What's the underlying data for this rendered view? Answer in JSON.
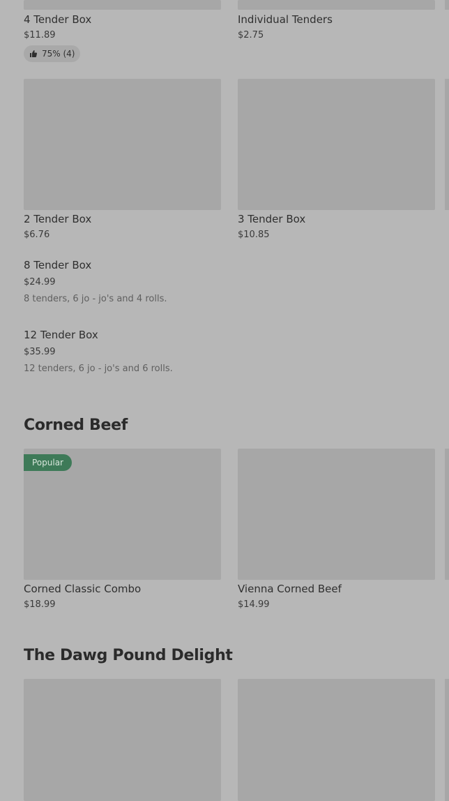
{
  "tenders": {
    "items": [
      {
        "name": "4 Tender Box",
        "price": "$11.89",
        "rating": "75% (4)"
      },
      {
        "name": "Individual Tenders",
        "price": "$2.75"
      },
      {
        "name": "2 Tender Box",
        "price": "$6.76"
      },
      {
        "name": "3 Tender Box",
        "price": "$10.85"
      },
      {
        "name": "8 Tender Box",
        "price": "$24.99",
        "description": "8 tenders, 6 jo - jo's and 4 rolls."
      },
      {
        "name": "12 Tender Box",
        "price": "$35.99",
        "description": "12 tenders, 6 jo - jo's and 6 rolls."
      }
    ]
  },
  "corned_beef": {
    "title": "Corned Beef",
    "items": [
      {
        "name": "Corned Classic Combo",
        "price": "$18.99",
        "badge": "Popular"
      },
      {
        "name": "Vienna Corned Beef",
        "price": "$14.99"
      }
    ]
  },
  "dawg_pound": {
    "title": "The Dawg Pound Delight"
  },
  "icons": {
    "rating": "thumbs-up-icon"
  },
  "colors": {
    "background": "#b7b7b7",
    "image_placeholder": "#a7a7a7",
    "popular_badge": "#3e7a58"
  }
}
